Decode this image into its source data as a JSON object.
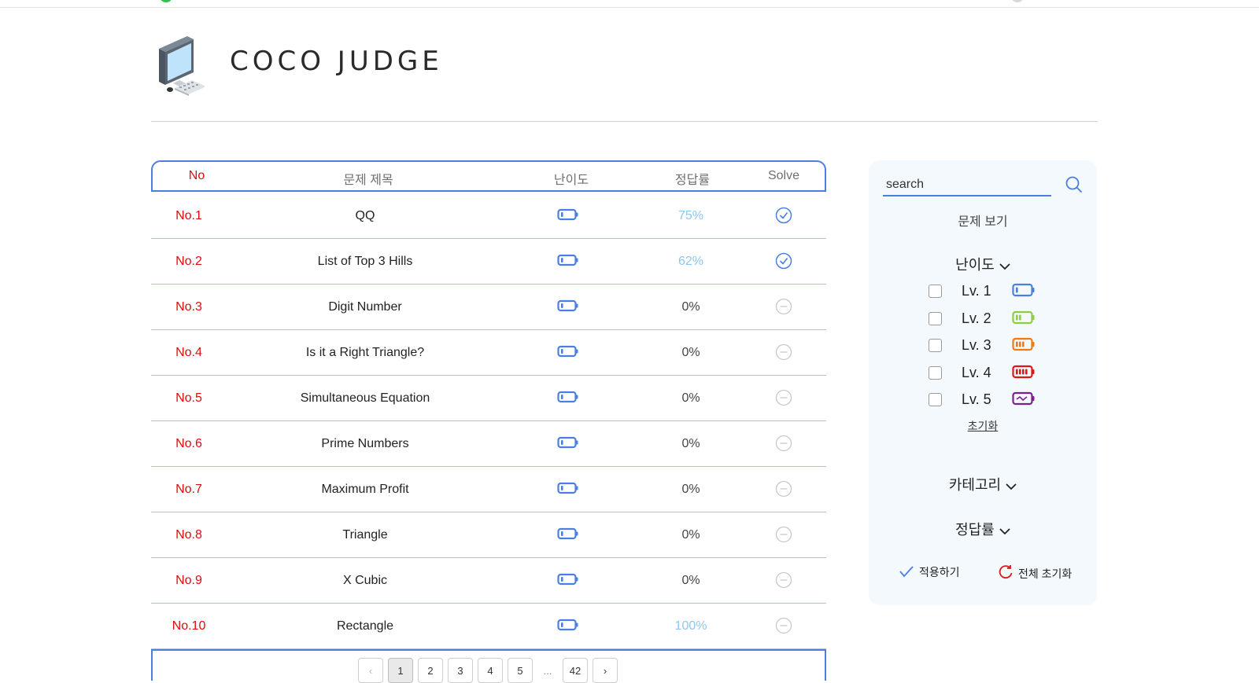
{
  "header": {
    "brand": "COCO JUDGE",
    "logo_icon": "computer-icon"
  },
  "table": {
    "columns": {
      "no": "No",
      "title": "문제 제목",
      "level": "난이도",
      "rate": "정답률",
      "solve": "Solve"
    },
    "rows": [
      {
        "no": "No.1",
        "title": "QQ",
        "level": 1,
        "rate": "75%",
        "solved": true,
        "rate_highlight": true
      },
      {
        "no": "No.2",
        "title": "List of Top 3 Hills",
        "level": 1,
        "rate": "62%",
        "solved": true,
        "rate_highlight": true
      },
      {
        "no": "No.3",
        "title": "Digit Number",
        "level": 1,
        "rate": "0%",
        "solved": false,
        "rate_highlight": false
      },
      {
        "no": "No.4",
        "title": "Is it a Right Triangle?",
        "level": 1,
        "rate": "0%",
        "solved": false,
        "rate_highlight": false
      },
      {
        "no": "No.5",
        "title": "Simultaneous Equation",
        "level": 1,
        "rate": "0%",
        "solved": false,
        "rate_highlight": false
      },
      {
        "no": "No.6",
        "title": "Prime Numbers",
        "level": 1,
        "rate": "0%",
        "solved": false,
        "rate_highlight": false
      },
      {
        "no": "No.7",
        "title": "Maximum Profit",
        "level": 1,
        "rate": "0%",
        "solved": false,
        "rate_highlight": false
      },
      {
        "no": "No.8",
        "title": "Triangle",
        "level": 1,
        "rate": "0%",
        "solved": false,
        "rate_highlight": false
      },
      {
        "no": "No.9",
        "title": "X Cubic",
        "level": 1,
        "rate": "0%",
        "solved": false,
        "rate_highlight": false
      },
      {
        "no": "No.10",
        "title": "Rectangle",
        "level": 1,
        "rate": "100%",
        "solved": false,
        "rate_highlight": true
      }
    ]
  },
  "pagination": {
    "prev": "‹",
    "pages": [
      "1",
      "2",
      "3",
      "4",
      "5"
    ],
    "ellipsis": "...",
    "last": "42",
    "next": "›",
    "current": "1"
  },
  "sidebar": {
    "search_placeholder": "search",
    "view_title": "문제 보기",
    "difficulty_label": "난이도",
    "levels": [
      {
        "label": "Lv. 1",
        "color": "#4a7fe0"
      },
      {
        "label": "Lv. 2",
        "color": "#8ccf3a"
      },
      {
        "label": "Lv. 3",
        "color": "#f07a12"
      },
      {
        "label": "Lv. 4",
        "color": "#e01515"
      },
      {
        "label": "Lv. 5",
        "color": "#7a1f8c"
      }
    ],
    "reset_label": "초기화",
    "category_label": "카테고리",
    "rate_label": "정답률",
    "apply_label": "적용하기",
    "reset_all_label": "전체 초기화"
  },
  "colors": {
    "accent": "#4a7fe0",
    "number_red": "#e10b0b",
    "rate_highlight": "#8cc7ef",
    "sidebar_bg": "#f3f9fd"
  }
}
